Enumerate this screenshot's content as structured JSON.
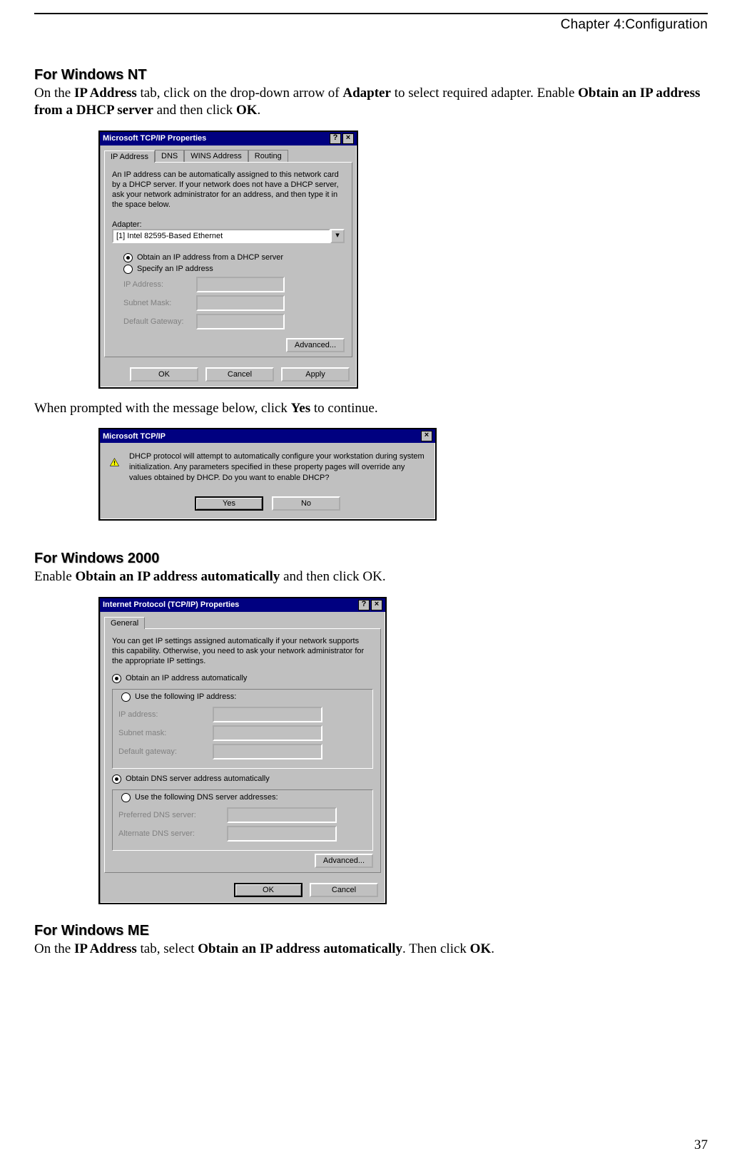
{
  "chapter_header": "Chapter 4:Configuration",
  "page_number": "37",
  "nt": {
    "heading": "For Windows NT",
    "intro_parts": [
      "On the ",
      "IP Address",
      " tab, click on the drop-down arrow of ",
      "Adapter",
      " to select required adapter. Enable ",
      "Obtain an IP address from a DHCP server",
      " and then click ",
      "OK",
      "."
    ],
    "dialog": {
      "title": "Microsoft TCP/IP Properties",
      "tabs": [
        "IP Address",
        "DNS",
        "WINS Address",
        "Routing"
      ],
      "desc": "An IP address can be automatically assigned to this network card by a DHCP server. If your network does not have a DHCP server, ask your network administrator for an address, and then type it in the space below.",
      "adapter_label": "Adapter:",
      "adapter_value": "[1] Intel 82595-Based Ethernet",
      "radio_dhcp": "Obtain an IP address from a DHCP server",
      "radio_specify": "Specify an IP address",
      "ip_label": "IP Address:",
      "mask_label": "Subnet Mask:",
      "gateway_label": "Default Gateway:",
      "btn_advanced": "Advanced...",
      "btn_ok": "OK",
      "btn_cancel": "Cancel",
      "btn_apply": "Apply"
    },
    "after_text_a": "When prompted with the message below, click ",
    "after_text_bold": "Yes",
    "after_text_b": " to continue.",
    "msgbox": {
      "title": "Microsoft TCP/IP",
      "body": "DHCP protocol will attempt to automatically configure your workstation during system initialization. Any parameters specified in these property pages will override any values obtained by DHCP. Do you want to enable DHCP?",
      "btn_yes": "Yes",
      "btn_no": "No"
    }
  },
  "w2000": {
    "heading": "For Windows 2000",
    "intro_a": "Enable ",
    "intro_bold": "Obtain an IP address automatically",
    "intro_b": " and then click OK.",
    "dialog": {
      "title": "Internet Protocol (TCP/IP) Properties",
      "tab_general": "General",
      "desc": "You can get IP settings assigned automatically if your network supports this capability. Otherwise, you need to ask your network administrator for the appropriate IP settings.",
      "radio_auto_ip": "Obtain an IP address automatically",
      "radio_use_ip": "Use the following IP address:",
      "ip_label": "IP address:",
      "mask_label": "Subnet mask:",
      "gateway_label": "Default gateway:",
      "radio_auto_dns": "Obtain DNS server address automatically",
      "radio_use_dns": "Use the following DNS server addresses:",
      "pref_dns_label": "Preferred DNS server:",
      "alt_dns_label": "Alternate DNS server:",
      "btn_advanced": "Advanced...",
      "btn_ok": "OK",
      "btn_cancel": "Cancel"
    }
  },
  "wme": {
    "heading": "For Windows ME",
    "intro_parts": [
      "On the ",
      "IP Address",
      " tab, select ",
      "Obtain an IP address automatically",
      ". Then click ",
      "OK",
      "."
    ]
  }
}
